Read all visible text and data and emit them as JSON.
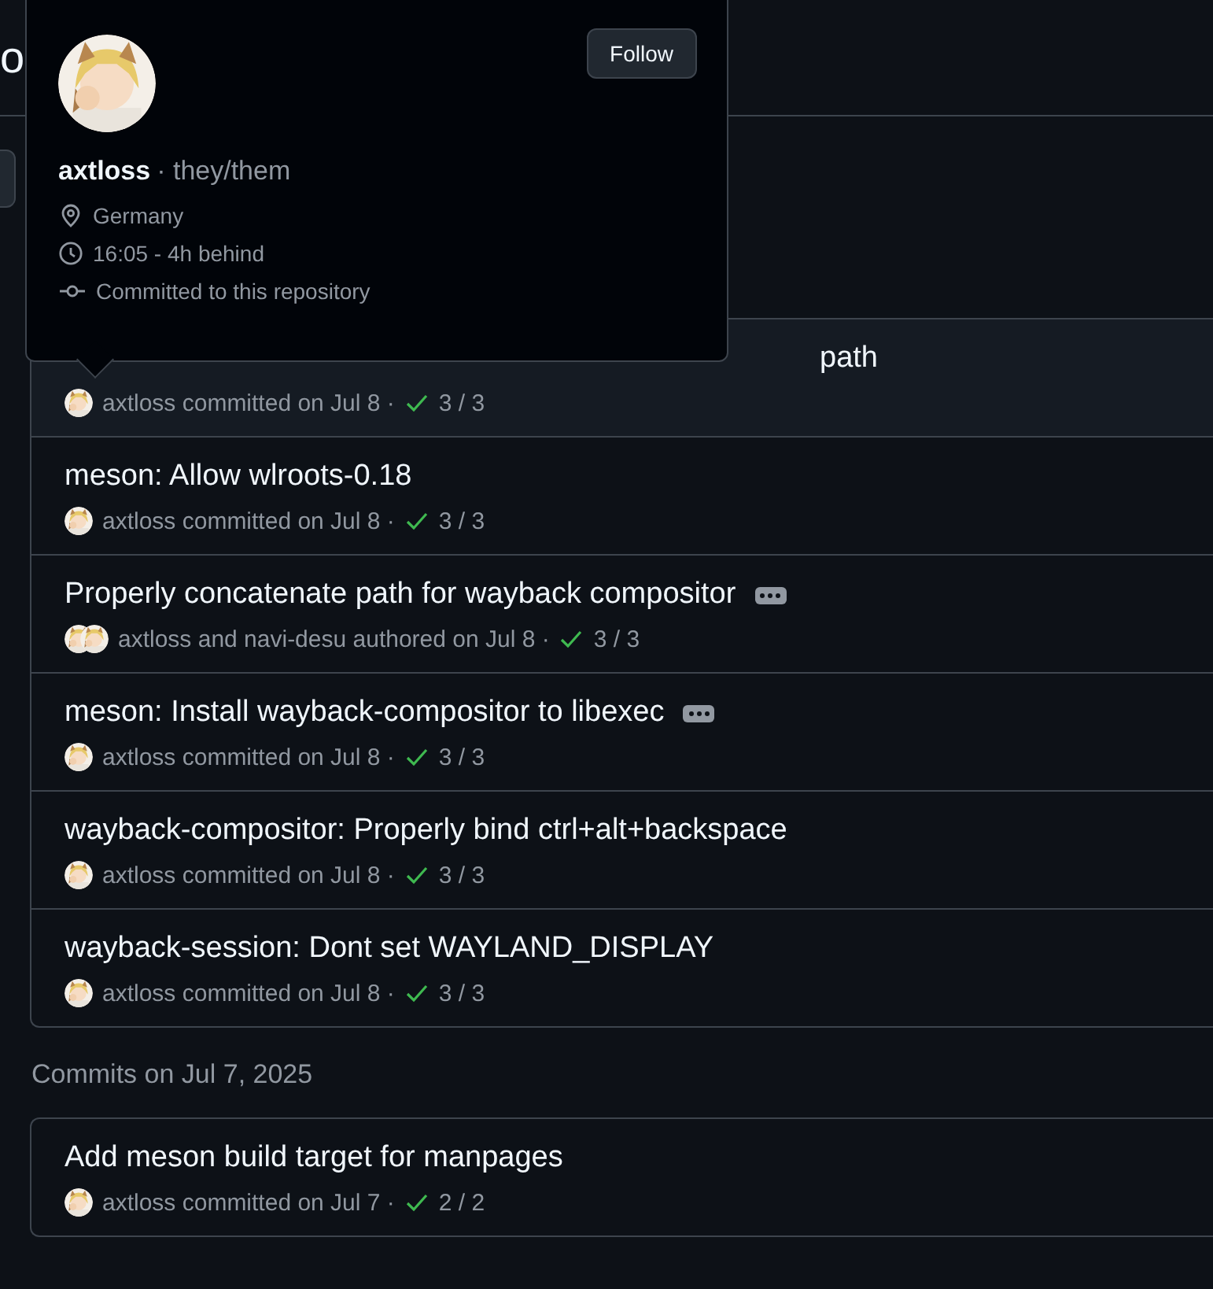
{
  "heading": "o",
  "groups": [
    {
      "commits": [
        {
          "title": "path",
          "partly_covered": true,
          "hovered": true,
          "has_description": false,
          "byline": "axtloss committed on Jul 8 ·",
          "checks_passed": true,
          "checks": "3 / 3"
        },
        {
          "title": "meson: Allow wlroots-0.18",
          "partly_covered": false,
          "hovered": false,
          "has_description": false,
          "byline": "axtloss committed on Jul 8 ·",
          "checks_passed": true,
          "checks": "3 / 3"
        },
        {
          "title": "Properly concatenate path for wayback compositor",
          "partly_covered": false,
          "hovered": false,
          "has_description": true,
          "byline": "axtloss and navi-desu authored on Jul 8 ·",
          "checks_passed": true,
          "checks": "3 / 3"
        },
        {
          "title": "meson: Install wayback-compositor to libexec",
          "partly_covered": false,
          "hovered": false,
          "has_description": true,
          "byline": "axtloss committed on Jul 8 ·",
          "checks_passed": true,
          "checks": "3 / 3"
        },
        {
          "title": "wayback-compositor: Properly bind ctrl+alt+backspace",
          "partly_covered": false,
          "hovered": false,
          "has_description": false,
          "byline": "axtloss committed on Jul 8 ·",
          "checks_passed": true,
          "checks": "3 / 3"
        },
        {
          "title": "wayback-session: Dont set WAYLAND_DISPLAY",
          "partly_covered": false,
          "hovered": false,
          "has_description": false,
          "byline": "axtloss committed on Jul 8 ·",
          "checks_passed": true,
          "checks": "3 / 3"
        }
      ]
    },
    {
      "date_label": "Commits on Jul 7, 2025",
      "commits": [
        {
          "title": "Add meson build target for manpages",
          "partly_covered": false,
          "hovered": false,
          "has_description": false,
          "byline": "axtloss committed on Jul 7 ·",
          "checks_passed": true,
          "checks": "2 / 2"
        }
      ]
    }
  ],
  "hovercard": {
    "name": "axtloss",
    "pronouns": "· they/them",
    "follow_label": "Follow",
    "details": [
      {
        "kind": "location",
        "text": "Germany"
      },
      {
        "kind": "time",
        "text": "16:05 - 4h behind"
      },
      {
        "kind": "commit",
        "text": "Committed to this repository"
      }
    ]
  }
}
